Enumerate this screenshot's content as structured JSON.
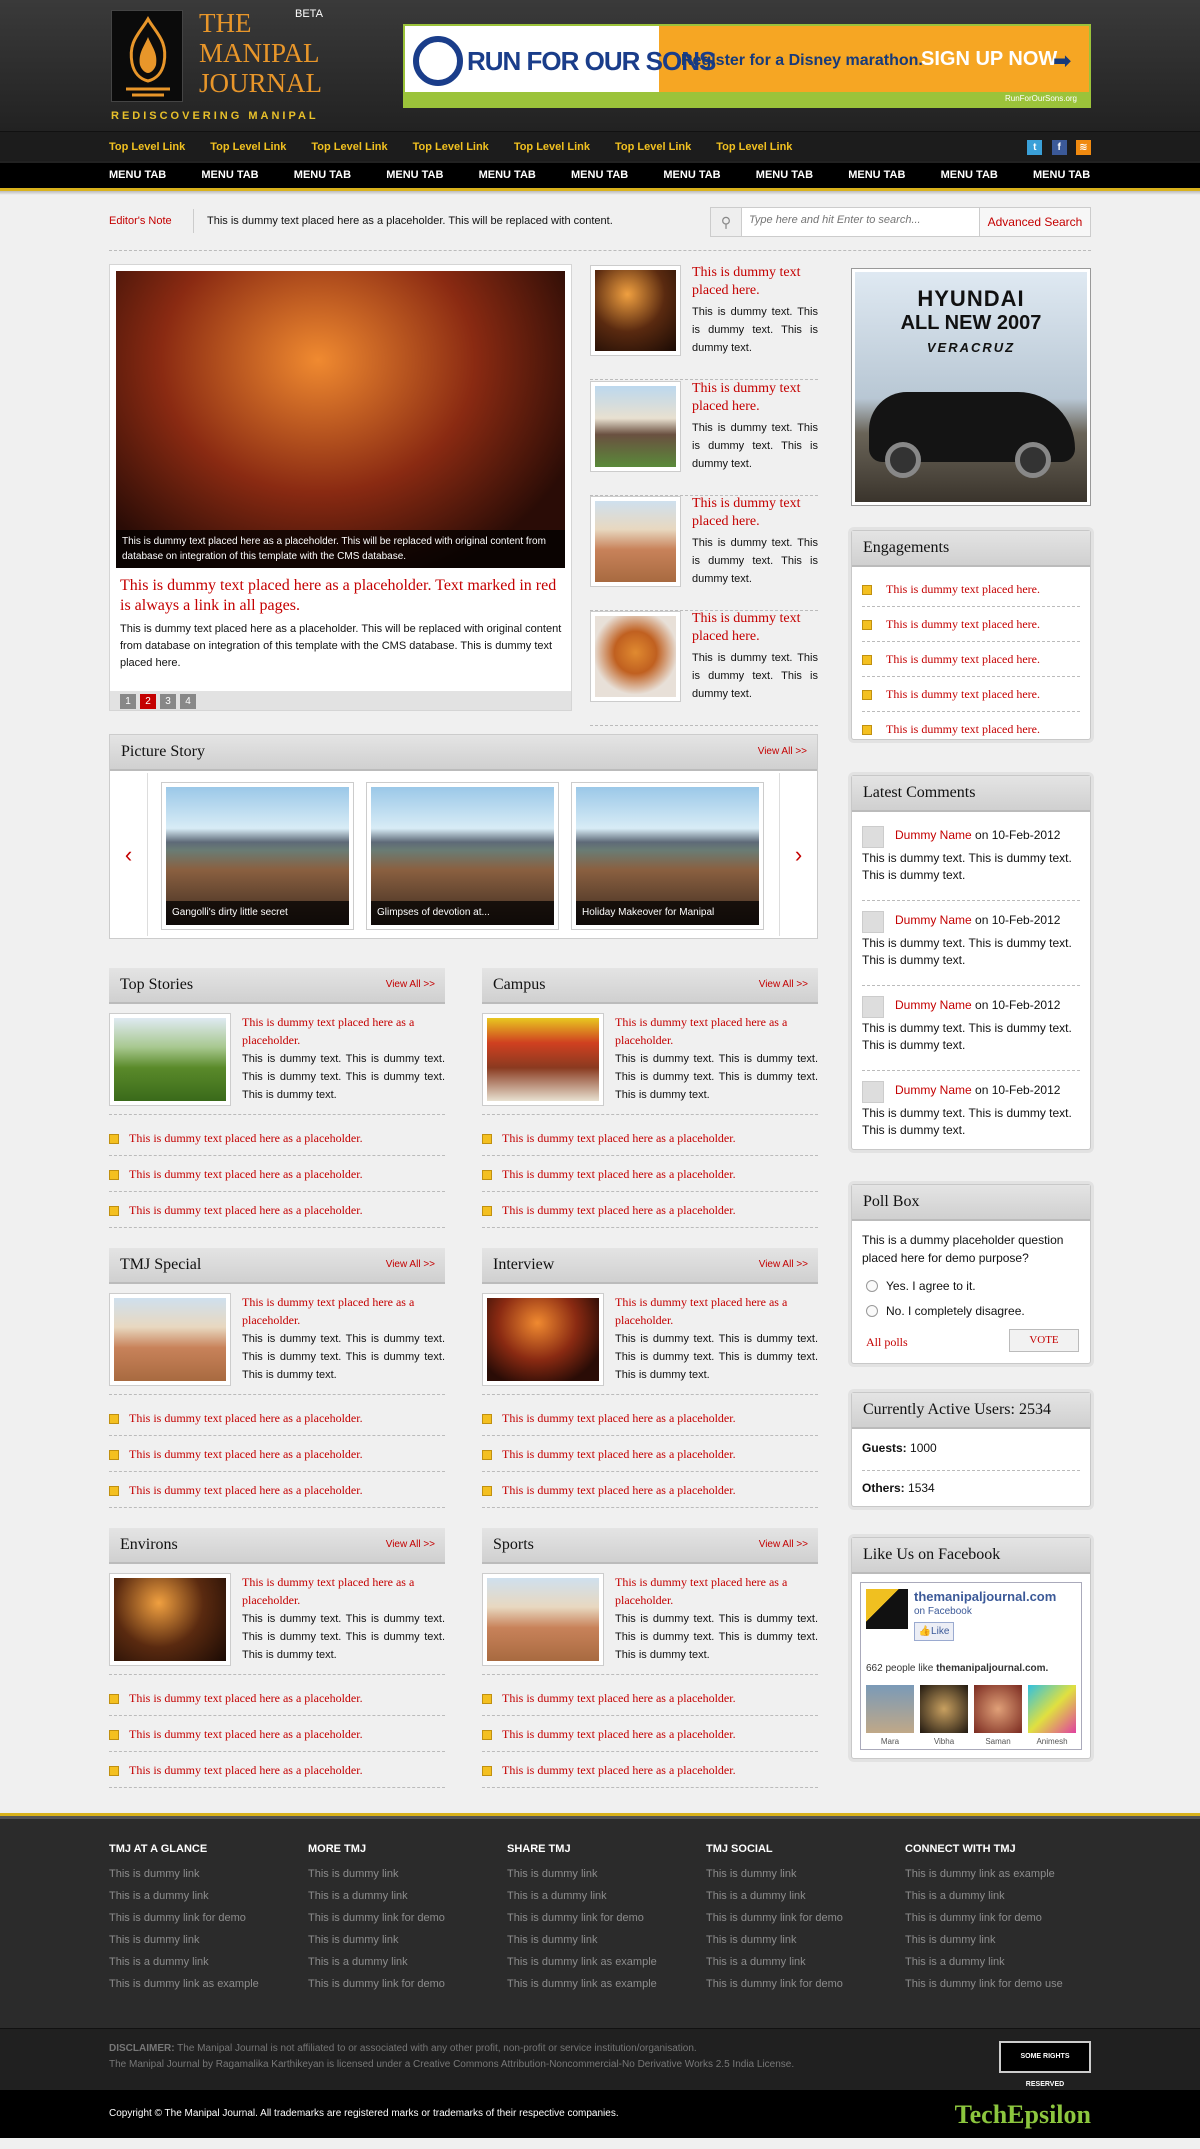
{
  "header": {
    "logo_text": "THE MANIPAL JOURNAL",
    "logo_line1": "THE",
    "logo_line2": "MANIPAL",
    "logo_line3": "JOURNAL",
    "beta": "BETA",
    "tagline": "REDISCOVERING MANIPAL",
    "banner": {
      "brand": "RUN FOR OUR SONS",
      "text": "Register for a Disney marathon.",
      "cta": "SIGN UP NOW",
      "url_text": "RunForOurSons.org"
    },
    "top_links": [
      "Top Level Link",
      "Top Level Link",
      "Top Level Link",
      "Top Level Link",
      "Top Level Link",
      "Top Level Link",
      "Top Level Link"
    ],
    "menu_tabs": [
      "MENU TAB",
      "MENU TAB",
      "MENU TAB",
      "MENU TAB",
      "MENU TAB",
      "MENU TAB",
      "MENU TAB",
      "MENU TAB",
      "MENU TAB",
      "MENU TAB",
      "MENU TAB"
    ]
  },
  "editor": {
    "label": "Editor's Note",
    "text": "This is dummy text placed here as a placeholder. This will be replaced with content.",
    "search_placeholder": "Type here and hit Enter to search...",
    "advanced_search": "Advanced Search"
  },
  "featured": {
    "caption": "This is dummy text placed here as a placeholder. This will be replaced with original content from database on integration of this template with the CMS database.",
    "title": "This is dummy text placed here as a placeholder. Text marked in red is always a link in all pages.",
    "body": "This is dummy text placed here as a placeholder. This will be replaced with original content from database on integration of this template with the CMS database. This is dummy text placed here.",
    "pages": [
      "1",
      "2",
      "3",
      "4"
    ]
  },
  "side_items": [
    {
      "title": "This is dummy text placed here.",
      "text": "This is dummy text. This is dummy text. This is dummy text."
    },
    {
      "title": "This is dummy text placed here.",
      "text": "This is dummy text. This is dummy text. This is dummy text."
    },
    {
      "title": "This is dummy text placed here.",
      "text": "This is dummy text. This is dummy text. This is dummy text."
    },
    {
      "title": "This is dummy text placed here.",
      "text": "This is dummy text. This is dummy text. This is dummy text."
    }
  ],
  "picture_story": {
    "title": "Picture Story",
    "view_all": "View All >>",
    "prev": "‹",
    "next": "›",
    "items": [
      "Gangolli's dirty little secret",
      "Glimpses of devotion at...",
      "Holiday Makeover for Manipal"
    ]
  },
  "sections": [
    {
      "title": "Top Stories",
      "view_all": "View All >>",
      "lead_title": "This is dummy text placed here as a placeholder.",
      "lead_text": "This is dummy text. This is dummy text. This is dummy text. This is dummy text. This is dummy text.",
      "links": [
        "This is dummy text placed here as a placeholder.",
        "This is dummy text placed here as a placeholder.",
        "This is dummy text placed here as a placeholder."
      ]
    },
    {
      "title": "Campus",
      "view_all": "View All >>",
      "lead_title": "This is dummy text placed here as a placeholder.",
      "lead_text": "This is dummy text. This is dummy text. This is dummy text. This is dummy text. This is dummy text.",
      "links": [
        "This is dummy text placed here as a placeholder.",
        "This is dummy text placed here as a placeholder.",
        "This is dummy text placed here as a placeholder."
      ]
    },
    {
      "title": "TMJ Special",
      "view_all": "View All >>",
      "lead_title": "This is dummy text placed here as a placeholder.",
      "lead_text": "This is dummy text. This is dummy text. This is dummy text. This is dummy text. This is dummy text.",
      "links": [
        "This is dummy text placed here as a placeholder.",
        "This is dummy text placed here as a placeholder.",
        "This is dummy text placed here as a placeholder."
      ]
    },
    {
      "title": "Interview",
      "view_all": "View All >>",
      "lead_title": "This is dummy text placed here as a placeholder.",
      "lead_text": "This is dummy text. This is dummy text. This is dummy text. This is dummy text. This is dummy text.",
      "links": [
        "This is dummy text placed here as a placeholder.",
        "This is dummy text placed here as a placeholder.",
        "This is dummy text placed here as a placeholder."
      ]
    },
    {
      "title": "Environs",
      "view_all": "View All >>",
      "lead_title": "This is dummy text placed here as a placeholder.",
      "lead_text": "This is dummy text. This is dummy text. This is dummy text. This is dummy text. This is dummy text.",
      "links": [
        "This is dummy text placed here as a placeholder.",
        "This is dummy text placed here as a placeholder.",
        "This is dummy text placed here as a placeholder."
      ]
    },
    {
      "title": "Sports",
      "view_all": "View All >>",
      "lead_title": "This is dummy text placed here as a placeholder.",
      "lead_text": "This is dummy text. This is dummy text. This is dummy text. This is dummy text. This is dummy text.",
      "links": [
        "This is dummy text placed here as a placeholder.",
        "This is dummy text placed here as a placeholder.",
        "This is dummy text placed here as a placeholder."
      ]
    }
  ],
  "sidebar": {
    "ad": {
      "brand": "HYUNDAI",
      "line": "ALL NEW 2007",
      "model": "VERACRUZ"
    },
    "engagements": {
      "title": "Engagements",
      "items": [
        "This is dummy text placed here.",
        "This is dummy text placed here.",
        "This is dummy text placed here.",
        "This is dummy text placed here.",
        "This is dummy text placed here."
      ]
    },
    "comments": {
      "title": "Latest Comments",
      "items": [
        {
          "name": "Dummy Name",
          "date": "on 10-Feb-2012",
          "text": "This is dummy text. This is dummy text. This is dummy text."
        },
        {
          "name": "Dummy Name",
          "date": "on 10-Feb-2012",
          "text": "This is dummy text. This is dummy text. This is dummy text."
        },
        {
          "name": "Dummy Name",
          "date": "on 10-Feb-2012",
          "text": "This is dummy text. This is dummy text. This is dummy text."
        },
        {
          "name": "Dummy Name",
          "date": "on 10-Feb-2012",
          "text": "This is dummy text. This is dummy text. This is dummy text."
        }
      ]
    },
    "poll": {
      "title": "Poll Box",
      "question": "This is a dummy placeholder question placed here for demo purpose?",
      "options": [
        "Yes. I agree to it.",
        "No. I completely disagree."
      ],
      "all_polls": "All polls",
      "vote": "VOTE"
    },
    "users": {
      "title": "Currently Active Users: 2534",
      "guests_label": "Guests:",
      "guests": "1000",
      "others_label": "Others:",
      "others": "1534"
    },
    "facebook": {
      "title": "Like Us on Facebook",
      "page": "themanipaljournal.com",
      "sub": "on Facebook",
      "like": "Like",
      "count_text": "662 people like",
      "count_page": "themanipaljournal.com.",
      "friends": [
        "Mara",
        "Vibha",
        "Saman",
        "Animesh"
      ]
    }
  },
  "footer": {
    "columns": [
      {
        "title": "TMJ AT A GLANCE",
        "links": [
          "This is dummy link",
          "This is a dummy link",
          "This is dummy link for demo",
          "This is dummy link",
          "This is a dummy link",
          "This is dummy link as example"
        ]
      },
      {
        "title": "MORE TMJ",
        "links": [
          "This is dummy link",
          "This is a dummy link",
          "This is dummy link for demo",
          "This is dummy link",
          "This is a dummy link",
          "This is dummy link for demo"
        ]
      },
      {
        "title": "SHARE TMJ",
        "links": [
          "This is dummy link",
          "This is a dummy link",
          "This is dummy link for demo",
          "This is dummy link",
          "This is dummy link as example",
          "This is dummy link as example"
        ]
      },
      {
        "title": "TMJ SOCIAL",
        "links": [
          "This is dummy link",
          "This is a dummy link",
          "This is dummy link for demo",
          "This is dummy link",
          "This is a dummy link",
          "This is dummy link for demo"
        ]
      },
      {
        "title": "CONNECT WITH TMJ",
        "links": [
          "This is dummy link as example",
          "This is a dummy link",
          "This is dummy link for demo",
          "This is dummy link",
          "This is a dummy link",
          "This is dummy link for demo use"
        ]
      }
    ],
    "disclaimer_label": "DISCLAIMER:",
    "disclaimer": "The Manipal Journal is not affiliated to or associated with any other profit, non-profit or service institution/organisation.",
    "license": "The Manipal Journal by Ragamalika Karthikeyan is licensed under a Creative Commons Attribution-Noncommercial-No Derivative Works 2.5 India License.",
    "cc_badge": "SOME RIGHTS RESERVED",
    "copyright": "Copyright © The Manipal Journal. All trademarks are registered marks or trademarks of their respective companies.",
    "brand": "TechEpsilon"
  }
}
